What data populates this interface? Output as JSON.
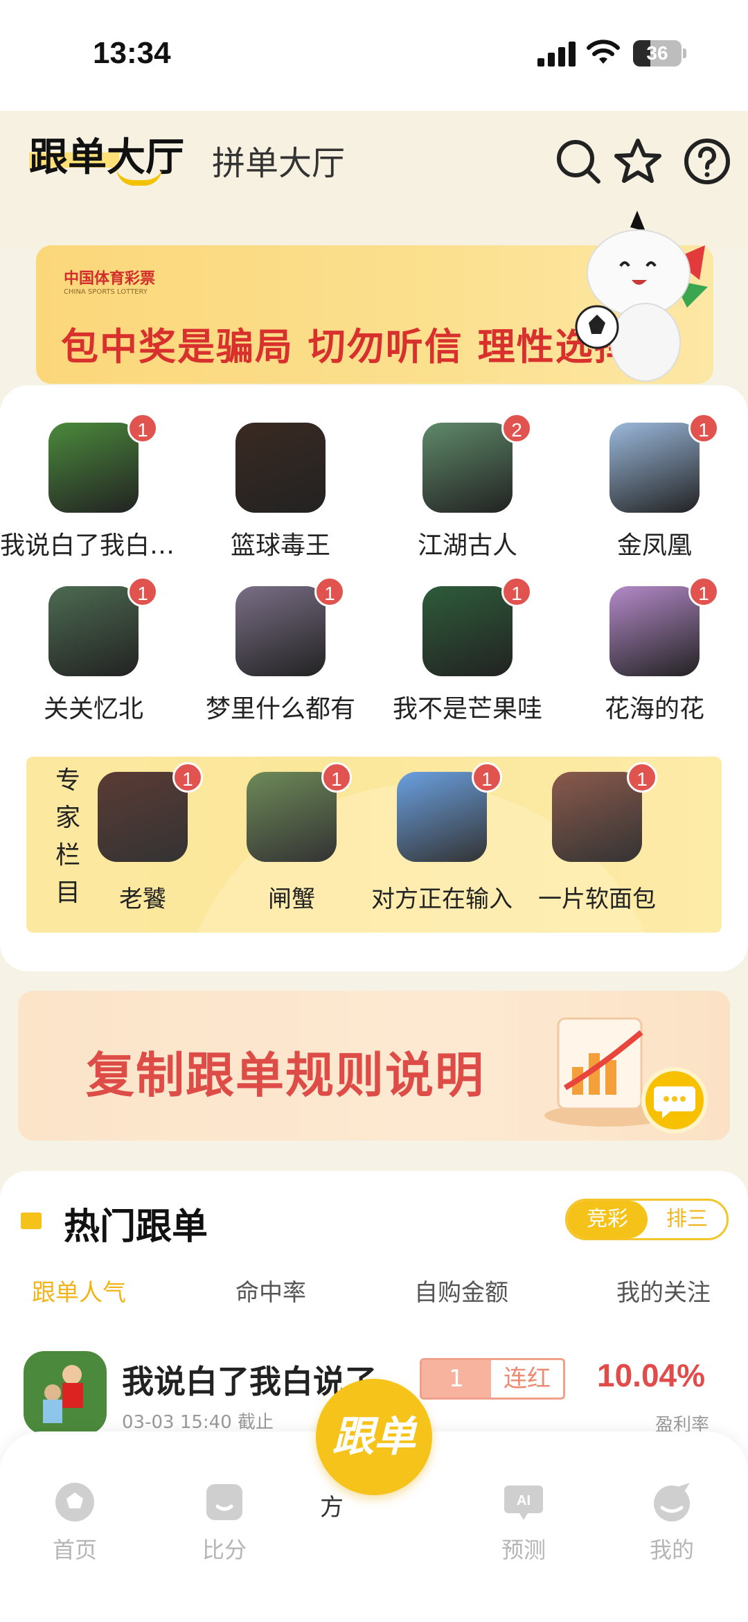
{
  "status_bar": {
    "time": "13:34",
    "battery": "36",
    "battery_level": 0.36
  },
  "header": {
    "active_tab": "跟单大厅",
    "inactive_tab": "拼单大厅",
    "icons": [
      "search-icon",
      "star-icon",
      "help-icon"
    ]
  },
  "lottery_banner": {
    "logo_text": "中国体育彩票",
    "logo_sub": "CHINA SPORTS LOTTERY",
    "slogan": "包中奖是骗局  切勿听信  理性选择"
  },
  "experts": [
    {
      "name": "我说白了我白说了",
      "badge": "1",
      "color": "#4b8a3c"
    },
    {
      "name": "篮球毒王",
      "badge": "",
      "color": "#3a2a22"
    },
    {
      "name": "江湖古人",
      "badge": "2",
      "color": "#5f8a6a"
    },
    {
      "name": "金凤凰",
      "badge": "1",
      "color": "#9bb9dc"
    },
    {
      "name": "关关忆北",
      "badge": "1",
      "color": "#4d6b52"
    },
    {
      "name": "梦里什么都有",
      "badge": "1",
      "color": "#7a6f86"
    },
    {
      "name": "我不是芒果哇",
      "badge": "1",
      "color": "#2e5c3a"
    },
    {
      "name": "花海的花",
      "badge": "1",
      "color": "#b48ac9"
    }
  ],
  "expert_column": {
    "label": "专家栏目",
    "items": [
      {
        "name": "老饕",
        "badge": "1",
        "color": "#5b3b34"
      },
      {
        "name": "闸蟹",
        "badge": "1",
        "color": "#6e8a58"
      },
      {
        "name": "对方正在输入",
        "badge": "1",
        "color": "#6aa0e0"
      },
      {
        "name": "一片软面包",
        "badge": "1",
        "color": "#8b5a4c"
      }
    ]
  },
  "rules_banner": {
    "text": "复制跟单规则说明"
  },
  "hot": {
    "title": "热门跟单",
    "segment": {
      "on": "竞彩",
      "off": "排三"
    },
    "sort_tabs": [
      "跟单人气",
      "命中率",
      "自购金额",
      "我的关注"
    ],
    "row": {
      "name": "我说白了我白说了",
      "sub": "03-03 15:40 截止",
      "streak_num": "1",
      "streak_label": "连红",
      "rate": "10.04%",
      "rate_label": "盈利率"
    }
  },
  "bottom_nav": {
    "items": [
      "首页",
      "比分",
      "预测",
      "我的"
    ],
    "fab": "跟单",
    "partial_text": "方"
  }
}
